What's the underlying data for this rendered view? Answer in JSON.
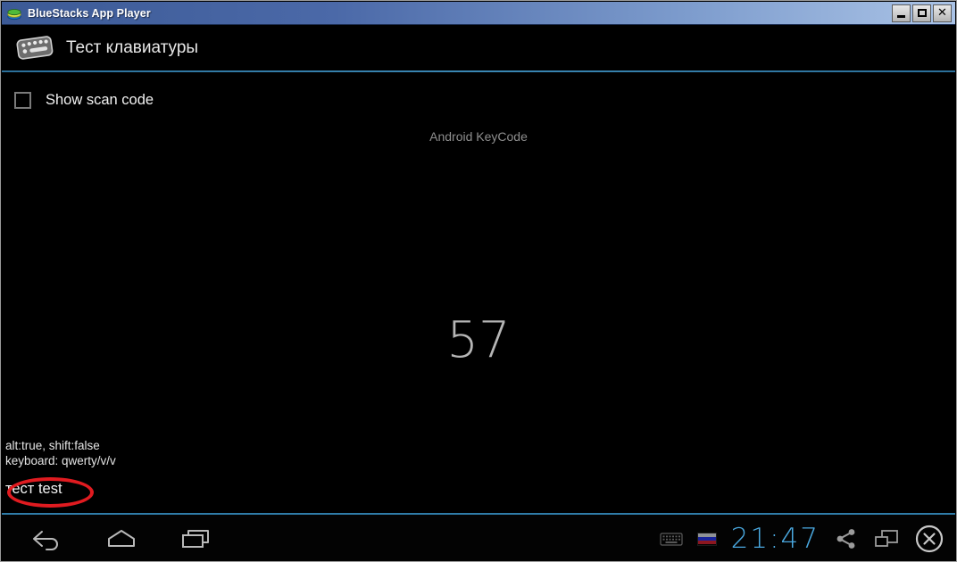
{
  "window": {
    "title": "BlueStacks App Player",
    "icon": "bluestacks-logo-icon",
    "controls": {
      "minimize": "minimize-button",
      "maximize": "maximize-button",
      "close_label": "✕"
    },
    "titlebar_gradient_start": "#3c5a96",
    "titlebar_gradient_end": "#aac3e6"
  },
  "app": {
    "title": "Тест клавиатуры",
    "icon": "keyboard-icon",
    "divider_color": "#2f7ca8"
  },
  "content": {
    "checkbox": {
      "label": "Show scan code",
      "checked": false
    },
    "keycode_label": "Android KeyCode",
    "keycode_value": "57",
    "status_line_1": "alt:true, shift:false",
    "status_line_2": "keyboard:  qwerty/v/v",
    "input_text": "тест test",
    "annotation": {
      "shape": "ellipse",
      "color": "#e01b20",
      "targets": "input_text"
    }
  },
  "navbar": {
    "back": "back-icon",
    "home": "home-icon",
    "recents": "recent-apps-icon",
    "keyboard": "keyboard-toggle-icon",
    "language_flag": "russian-flag-icon",
    "clock": "21:47",
    "clock_color": "#4aa8df",
    "share": "share-icon",
    "resize": "resize-window-icon",
    "close": "close-circle-icon"
  }
}
